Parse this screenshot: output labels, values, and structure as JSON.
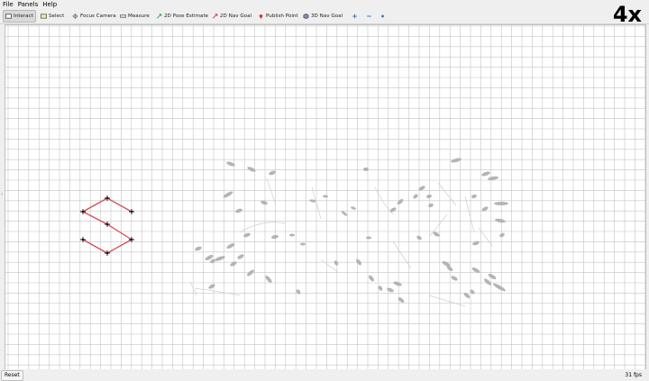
{
  "menu": {
    "file": "File",
    "panels": "Panels",
    "help": "Help"
  },
  "toolbar": {
    "interact": "Interact",
    "select": "Select",
    "focus_camera": "Focus Camera",
    "measure": "Measure",
    "pose_estimate": "2D Pose Estimate",
    "nav_goal": "2D Nav Goal",
    "publish_point": "Publish Point",
    "nav_goal_3d": "3D Nav Goal"
  },
  "overlay": {
    "speed": "4x"
  },
  "status": {
    "reset": "Reset",
    "fps": "31 fps"
  },
  "colors": {
    "path": "#d64d5b",
    "grid": "#c4c4c4",
    "cloud": "#b4b4b4"
  }
}
